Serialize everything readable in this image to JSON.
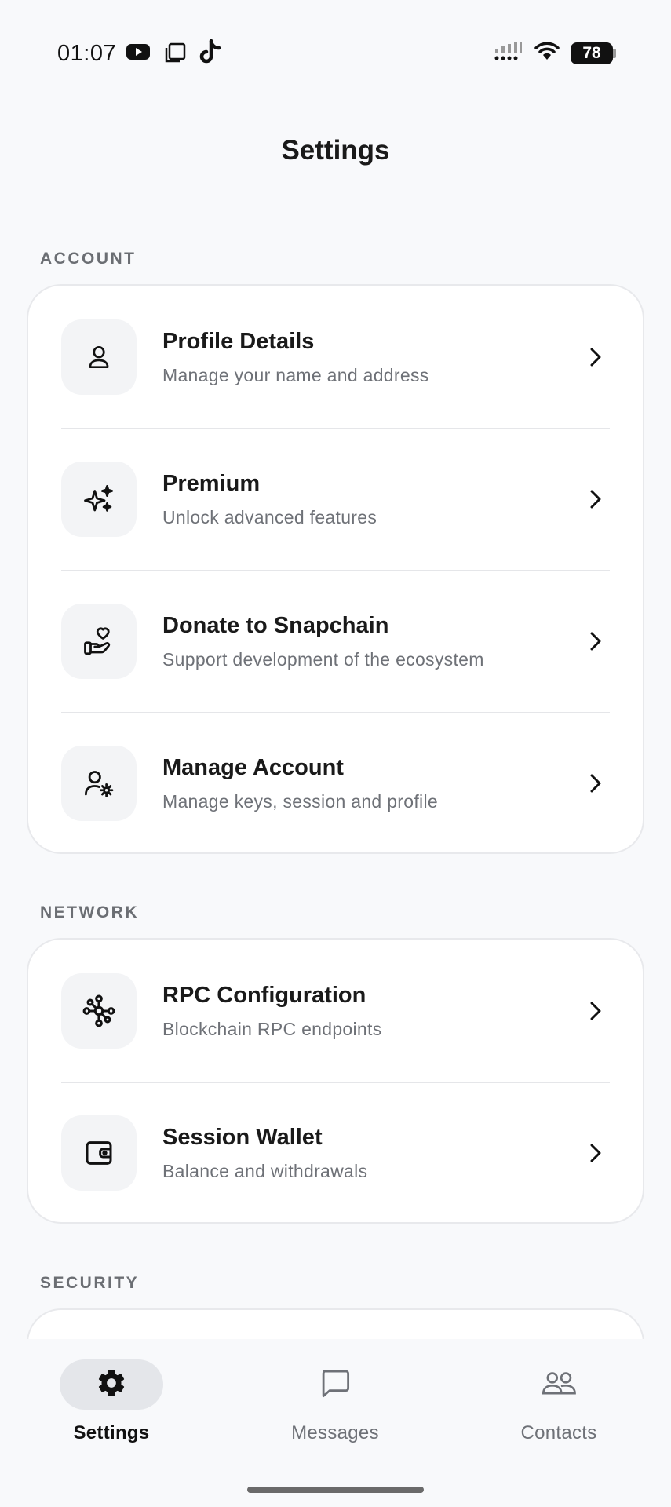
{
  "status_bar": {
    "time": "01:07",
    "battery": "78",
    "icons": [
      "youtube-icon",
      "screen-icon",
      "tiktok-icon",
      "signal-icon",
      "wifi-icon",
      "battery-icon"
    ]
  },
  "header": {
    "title": "Settings"
  },
  "sections": {
    "account": {
      "label": "ACCOUNT",
      "items": [
        {
          "title": "Profile Details",
          "subtitle": "Manage your name and address",
          "icon": "user-icon"
        },
        {
          "title": "Premium",
          "subtitle": "Unlock advanced features",
          "icon": "sparkles-icon"
        },
        {
          "title": "Donate to Snapchain",
          "subtitle": "Support development of the ecosystem",
          "icon": "hand-heart-icon"
        },
        {
          "title": "Manage Account",
          "subtitle": "Manage keys, session and profile",
          "icon": "user-gear-icon"
        }
      ]
    },
    "network": {
      "label": "NETWORK",
      "items": [
        {
          "title": "RPC Configuration",
          "subtitle": "Blockchain RPC endpoints",
          "icon": "network-icon"
        },
        {
          "title": "Session Wallet",
          "subtitle": "Balance and withdrawals",
          "icon": "wallet-icon"
        }
      ]
    },
    "security": {
      "label": "SECURITY"
    }
  },
  "bottom_nav": {
    "items": [
      {
        "label": "Settings",
        "icon": "gear-icon",
        "active": true
      },
      {
        "label": "Messages",
        "icon": "message-icon",
        "active": false
      },
      {
        "label": "Contacts",
        "icon": "contacts-icon",
        "active": false
      }
    ]
  },
  "colors": {
    "background": "#F8F9FB",
    "card": "#FFFFFF",
    "text_primary": "#1A1A1A",
    "text_secondary": "#6E7177",
    "active_pill": "#E4E6EA"
  }
}
